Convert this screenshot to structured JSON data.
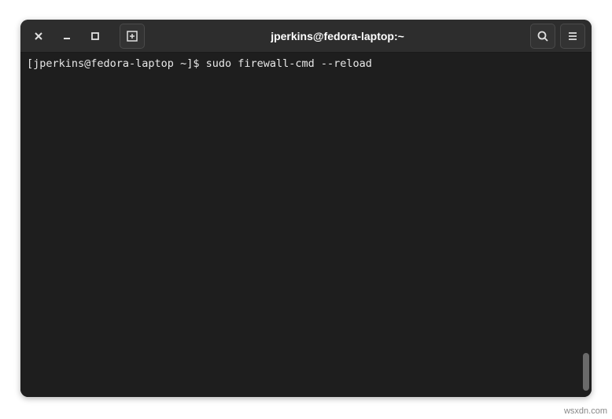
{
  "window": {
    "title": "jperkins@fedora-laptop:~"
  },
  "terminal": {
    "prompt": "[jperkins@fedora-laptop ~]$ ",
    "command": "sudo firewall-cmd --reload"
  },
  "watermark": "wsxdn.com"
}
